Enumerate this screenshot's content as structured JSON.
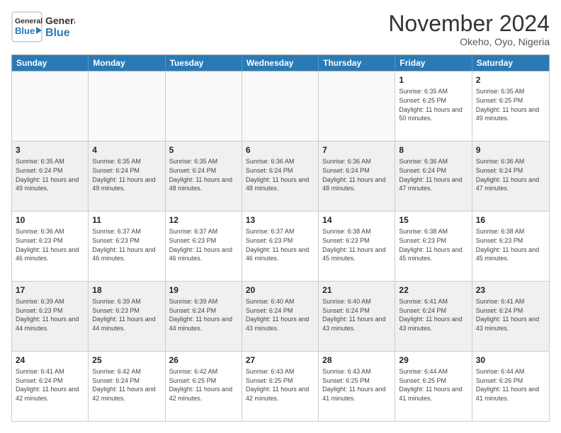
{
  "logo": {
    "line1": "General",
    "line2": "Blue"
  },
  "title": "November 2024",
  "subtitle": "Okeho, Oyo, Nigeria",
  "header_days": [
    "Sunday",
    "Monday",
    "Tuesday",
    "Wednesday",
    "Thursday",
    "Friday",
    "Saturday"
  ],
  "weeks": [
    [
      {
        "day": "",
        "info": ""
      },
      {
        "day": "",
        "info": ""
      },
      {
        "day": "",
        "info": ""
      },
      {
        "day": "",
        "info": ""
      },
      {
        "day": "",
        "info": ""
      },
      {
        "day": "1",
        "info": "Sunrise: 6:35 AM\nSunset: 6:25 PM\nDaylight: 11 hours and 50 minutes."
      },
      {
        "day": "2",
        "info": "Sunrise: 6:35 AM\nSunset: 6:25 PM\nDaylight: 11 hours and 49 minutes."
      }
    ],
    [
      {
        "day": "3",
        "info": "Sunrise: 6:35 AM\nSunset: 6:24 PM\nDaylight: 11 hours and 49 minutes."
      },
      {
        "day": "4",
        "info": "Sunrise: 6:35 AM\nSunset: 6:24 PM\nDaylight: 11 hours and 49 minutes."
      },
      {
        "day": "5",
        "info": "Sunrise: 6:35 AM\nSunset: 6:24 PM\nDaylight: 11 hours and 48 minutes."
      },
      {
        "day": "6",
        "info": "Sunrise: 6:36 AM\nSunset: 6:24 PM\nDaylight: 11 hours and 48 minutes."
      },
      {
        "day": "7",
        "info": "Sunrise: 6:36 AM\nSunset: 6:24 PM\nDaylight: 11 hours and 48 minutes."
      },
      {
        "day": "8",
        "info": "Sunrise: 6:36 AM\nSunset: 6:24 PM\nDaylight: 11 hours and 47 minutes."
      },
      {
        "day": "9",
        "info": "Sunrise: 6:36 AM\nSunset: 6:24 PM\nDaylight: 11 hours and 47 minutes."
      }
    ],
    [
      {
        "day": "10",
        "info": "Sunrise: 6:36 AM\nSunset: 6:23 PM\nDaylight: 11 hours and 46 minutes."
      },
      {
        "day": "11",
        "info": "Sunrise: 6:37 AM\nSunset: 6:23 PM\nDaylight: 11 hours and 46 minutes."
      },
      {
        "day": "12",
        "info": "Sunrise: 6:37 AM\nSunset: 6:23 PM\nDaylight: 11 hours and 46 minutes."
      },
      {
        "day": "13",
        "info": "Sunrise: 6:37 AM\nSunset: 6:23 PM\nDaylight: 11 hours and 46 minutes."
      },
      {
        "day": "14",
        "info": "Sunrise: 6:38 AM\nSunset: 6:23 PM\nDaylight: 11 hours and 45 minutes."
      },
      {
        "day": "15",
        "info": "Sunrise: 6:38 AM\nSunset: 6:23 PM\nDaylight: 11 hours and 45 minutes."
      },
      {
        "day": "16",
        "info": "Sunrise: 6:38 AM\nSunset: 6:23 PM\nDaylight: 11 hours and 45 minutes."
      }
    ],
    [
      {
        "day": "17",
        "info": "Sunrise: 6:39 AM\nSunset: 6:23 PM\nDaylight: 11 hours and 44 minutes."
      },
      {
        "day": "18",
        "info": "Sunrise: 6:39 AM\nSunset: 6:23 PM\nDaylight: 11 hours and 44 minutes."
      },
      {
        "day": "19",
        "info": "Sunrise: 6:39 AM\nSunset: 6:24 PM\nDaylight: 11 hours and 44 minutes."
      },
      {
        "day": "20",
        "info": "Sunrise: 6:40 AM\nSunset: 6:24 PM\nDaylight: 11 hours and 43 minutes."
      },
      {
        "day": "21",
        "info": "Sunrise: 6:40 AM\nSunset: 6:24 PM\nDaylight: 11 hours and 43 minutes."
      },
      {
        "day": "22",
        "info": "Sunrise: 6:41 AM\nSunset: 6:24 PM\nDaylight: 11 hours and 43 minutes."
      },
      {
        "day": "23",
        "info": "Sunrise: 6:41 AM\nSunset: 6:24 PM\nDaylight: 11 hours and 43 minutes."
      }
    ],
    [
      {
        "day": "24",
        "info": "Sunrise: 6:41 AM\nSunset: 6:24 PM\nDaylight: 11 hours and 42 minutes."
      },
      {
        "day": "25",
        "info": "Sunrise: 6:42 AM\nSunset: 6:24 PM\nDaylight: 11 hours and 42 minutes."
      },
      {
        "day": "26",
        "info": "Sunrise: 6:42 AM\nSunset: 6:25 PM\nDaylight: 11 hours and 42 minutes."
      },
      {
        "day": "27",
        "info": "Sunrise: 6:43 AM\nSunset: 6:25 PM\nDaylight: 11 hours and 42 minutes."
      },
      {
        "day": "28",
        "info": "Sunrise: 6:43 AM\nSunset: 6:25 PM\nDaylight: 11 hours and 41 minutes."
      },
      {
        "day": "29",
        "info": "Sunrise: 6:44 AM\nSunset: 6:25 PM\nDaylight: 11 hours and 41 minutes."
      },
      {
        "day": "30",
        "info": "Sunrise: 6:44 AM\nSunset: 6:26 PM\nDaylight: 11 hours and 41 minutes."
      }
    ]
  ]
}
